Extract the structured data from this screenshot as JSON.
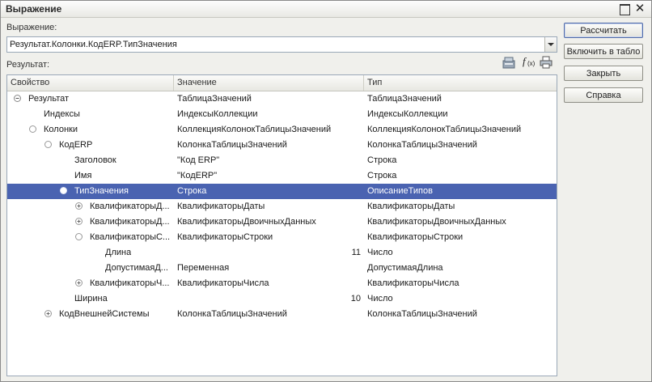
{
  "window": {
    "title": "Выражение"
  },
  "expression": {
    "label": "Выражение:",
    "value": "Результат.Колонки.КодERP.ТипЗначения"
  },
  "result": {
    "label": "Результат:"
  },
  "toolbar_icons": [
    "database-icon",
    "function-fx-icon",
    "print-icon"
  ],
  "table": {
    "columns": [
      "Свойство",
      "Значение",
      "Тип"
    ],
    "rows": [
      {
        "name": "Результат",
        "value": "ТаблицаЗначений",
        "type": "ТаблицаЗначений"
      },
      {
        "name": "Индексы",
        "value": "ИндексыКоллекции",
        "type": "ИндексыКоллекции"
      },
      {
        "name": "Колонки",
        "value": "КоллекцияКолонокТаблицыЗначений",
        "type": "КоллекцияКолонокТаблицыЗначений"
      },
      {
        "name": "КодERP",
        "value": "КолонкаТаблицыЗначений",
        "type": "КолонкаТаблицыЗначений"
      },
      {
        "name": "Заголовок",
        "value": "\"Код ERP\"",
        "type": "Строка"
      },
      {
        "name": "Имя",
        "value": "\"КодERP\"",
        "type": "Строка"
      },
      {
        "name": "ТипЗначения",
        "value": "Строка",
        "type": "ОписаниеТипов"
      },
      {
        "name": "КвалификаторыД...",
        "value": "КвалификаторыДаты",
        "type": "КвалификаторыДаты"
      },
      {
        "name": "КвалификаторыД...",
        "value": "КвалификаторыДвоичныхДанных",
        "type": "КвалификаторыДвоичныхДанных"
      },
      {
        "name": "КвалификаторыС...",
        "value": "КвалификаторыСтроки",
        "type": "КвалификаторыСтроки"
      },
      {
        "name": "Длина",
        "value": "11",
        "type": "Число"
      },
      {
        "name": "ДопустимаяД...",
        "value": "Переменная",
        "type": "ДопустимаяДлина"
      },
      {
        "name": "КвалификаторыЧ...",
        "value": "КвалификаторыЧисла",
        "type": "КвалификаторыЧисла"
      },
      {
        "name": "Ширина",
        "value": "10",
        "type": "Число"
      },
      {
        "name": "КодВнешнейСистемы",
        "value": "КолонкаТаблицыЗначений",
        "type": "КолонкаТаблицыЗначений"
      }
    ]
  },
  "buttons": {
    "calculate": "Рассчитать",
    "add_to_table": "Включить в табло",
    "close": "Закрыть",
    "help": "Справка"
  },
  "colors": {
    "selection": "#4a63b1"
  }
}
